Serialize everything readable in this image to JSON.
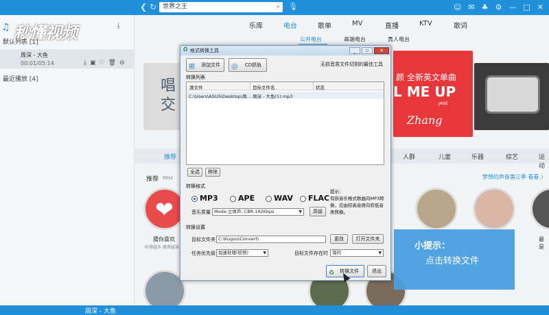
{
  "topbar": {
    "search_value": "世界之王"
  },
  "left": {
    "logo": "秒懂视频",
    "default_list": "默认列表 [1]",
    "song_title": "周深 - 大鱼",
    "song_time": "00:01/05:14",
    "recent": "最近播放 [4]"
  },
  "nav": {
    "tabs": [
      "乐库",
      "电台",
      "歌单",
      "MV",
      "直播",
      "KTV",
      "歌词"
    ]
  },
  "subnav": {
    "tabs": [
      "公共电台",
      "高端电台",
      "真人电台"
    ]
  },
  "banners": {
    "left_text_1": "唱",
    "left_text_2": "交",
    "center_text_1": "颜 全新英文单曲",
    "center_text_2": "L ME UP",
    "center_text_3": "JANE",
    "center_text_4": "Zhang"
  },
  "categories": [
    "推荐",
    "人群",
    "儿童",
    "乐器",
    "综艺",
    "运动"
  ],
  "recommend": {
    "label": "推荐",
    "sub": "MHz",
    "link": "梦想的声音第三季 看看 〉"
  },
  "circles": {
    "c1_label": "猜你喜欢",
    "c1_sub": "听得越多 猜得越准",
    "c6_label": "最是"
  },
  "bottombar": {
    "text": "周深 - 大鱼"
  },
  "dialog": {
    "title": "格式转换工具",
    "add_file": "添加文件",
    "cd_rip": "CD抓轨",
    "slogan": "无损音质文件切割的最佳工具",
    "list_label": "转换列表",
    "columns": [
      "源文件",
      "目标文件名",
      "状态"
    ],
    "row": {
      "source": "C:\\Users\\ASUS\\Desktop\\周...",
      "target": "周深 - 大鱼(1).mp3",
      "status": ""
    },
    "select_all": "全选",
    "remove": "移除",
    "format_label": "转换格式",
    "formats": [
      "MP3",
      "APE",
      "WAV",
      "FLAC"
    ],
    "selected_format": "MP3",
    "hint_title": "提示：",
    "hint_body": "有损音乐格式歌曲向MP3转换，应由较高音质向较低音质转换。",
    "quality_label": "音乐质量",
    "quality_value": "Mode:立体声; CBR:192Kbps",
    "advanced": "高级",
    "settings_label": "转换设置",
    "target_folder_label": "目标文件夹",
    "target_folder_value": "C:\\Kugou\\Convert\\",
    "change": "更改",
    "open_folder": "打开文件夹",
    "priority_label": "任务优先级",
    "priority_value": "加速处理(较快)",
    "exists_label": "目标文件存在时",
    "exists_value": "询问",
    "convert": "转换文件",
    "exit": "退出"
  },
  "tooltip": {
    "title": "小提示：",
    "body": "点击转换文件"
  }
}
